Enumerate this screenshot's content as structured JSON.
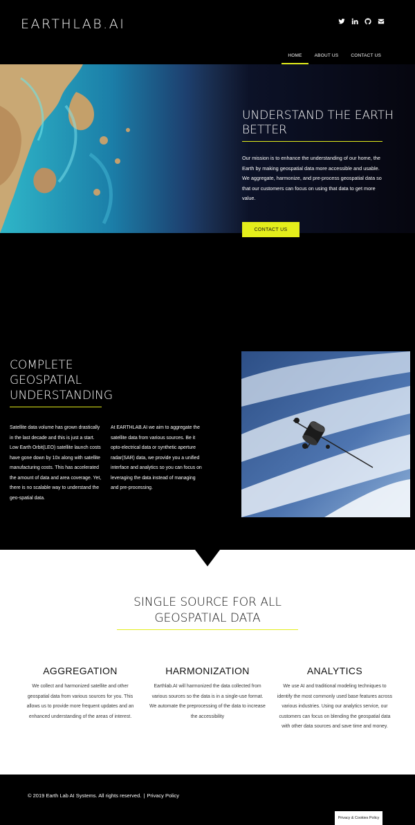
{
  "header": {
    "logo": "EARTHLAB.AI",
    "social": [
      "twitter-icon",
      "linkedin-icon",
      "github-icon",
      "email-icon"
    ],
    "nav": [
      {
        "label": "HOME",
        "active": true
      },
      {
        "label": "ABOUT US",
        "active": false
      },
      {
        "label": "CONTACT US",
        "active": false
      }
    ]
  },
  "hero": {
    "title": "UNDERSTAND THE EARTH BETTER",
    "text": "Our mission is to enhance the understanding of our home, the Earth by making geospatial data more accessible and usable. We aggregate, harmonize, and pre-process geospatial data so that our customers can focus on using that data to get more value.",
    "cta": "CONTACT US"
  },
  "understanding": {
    "title": "COMPLETE GEOSPATIAL UNDERSTANDING",
    "col1": "Satellite data volume has grown drastically in the last decade and this is just a start. Low Earth Orbit(LEO) satellite launch costs have gone down by 10x along with satellite manufacturing costs. This has accelerated the amount of data and area coverage. Yet, there is no scalable way to understand the geo-spatial data.",
    "col2": "At EARTHLAB.AI we aim to aggregate the satellite data from various sources. Be it opto-electrical data or synthetic aperture radar(SAR) data, we provide you a unified interface and analytics so you can focus on leveraging the data instead of managing and pre-processing."
  },
  "single_source": {
    "title": "SINGLE SOURCE FOR ALL GEOSPATIAL DATA",
    "features": [
      {
        "title": "AGGREGATION",
        "text": "We collect and harmonized satellite and other geospatial data from various sources for you. This allows us to provide more frequent updates and an enhanced understanding of the areas of interest."
      },
      {
        "title": "HARMONIZATION",
        "text": "Earthlab.AI will harmonized the data collected from various sources so the data is in a single-use format. We automate the preprocessing of the data to increase the accessibility"
      },
      {
        "title": "ANALYTICS",
        "text": "We use AI and traditional modeling techniques to identify the most commonly used base features across various industries. Using our analytics service, our customers can focus on blending the geospatial data with other data sources and save time and money."
      }
    ]
  },
  "footer": {
    "copyright": "© 2019 Earth Lab AI Systems. All rights reserved.",
    "separator": "|",
    "privacy_link": "Privacy Policy",
    "cookie_button": "Privacy & Cookies Policy"
  },
  "colors": {
    "accent": "#e4ee1b",
    "background": "#000000"
  }
}
